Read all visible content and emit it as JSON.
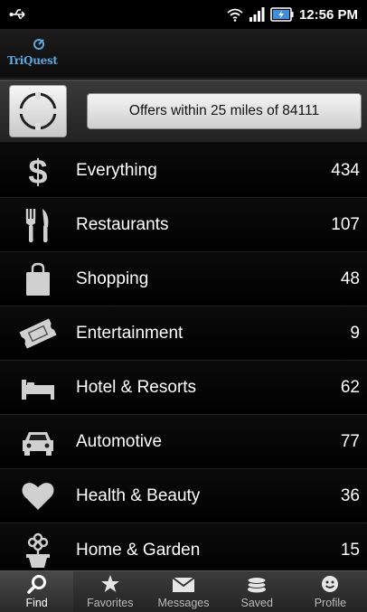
{
  "status_bar": {
    "time": "12:56 PM"
  },
  "app": {
    "logo_text": "TriQuest"
  },
  "location": {
    "offers_label": "Offers within 25 miles of 84111"
  },
  "categories": [
    {
      "label": "Everything",
      "count": "434",
      "icon": "dollar-icon"
    },
    {
      "label": "Restaurants",
      "count": "107",
      "icon": "fork-knife-icon"
    },
    {
      "label": "Shopping",
      "count": "48",
      "icon": "shopping-bag-icon"
    },
    {
      "label": "Entertainment",
      "count": "9",
      "icon": "ticket-icon"
    },
    {
      "label": "Hotel & Resorts",
      "count": "62",
      "icon": "bed-icon"
    },
    {
      "label": "Automotive",
      "count": "77",
      "icon": "car-icon"
    },
    {
      "label": "Health & Beauty",
      "count": "36",
      "icon": "heart-icon"
    },
    {
      "label": "Home & Garden",
      "count": "15",
      "icon": "flower-pot-icon"
    }
  ],
  "tabs": [
    {
      "label": "Find",
      "icon": "search-icon",
      "active": true
    },
    {
      "label": "Favorites",
      "icon": "star-icon",
      "active": false
    },
    {
      "label": "Messages",
      "icon": "envelope-icon",
      "active": false
    },
    {
      "label": "Saved",
      "icon": "coins-icon",
      "active": false
    },
    {
      "label": "Profile",
      "icon": "smiley-icon",
      "active": false
    }
  ],
  "colors": {
    "background": "#000000",
    "accent": "#5aa7e0",
    "icon_gray": "#d0d0d0"
  }
}
